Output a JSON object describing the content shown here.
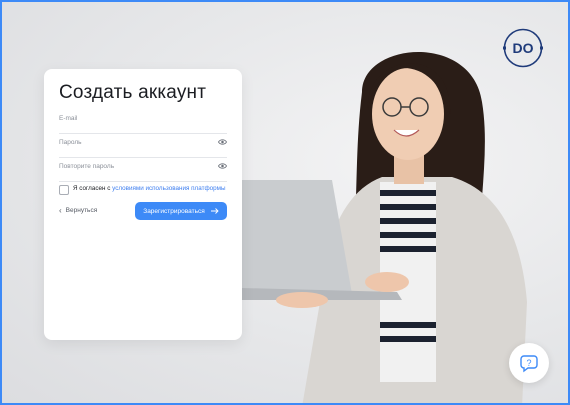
{
  "form": {
    "title": "Создать аккаунт",
    "fields": [
      {
        "label": "E-mail"
      },
      {
        "label": "Пароль"
      },
      {
        "label": "Повторите пароль"
      }
    ],
    "agree_prefix": "Я согласен с ",
    "agree_link": "условиями использования платформы",
    "back_label": "Вернуться",
    "submit_label": "Зарегистрироваться"
  },
  "brand": {
    "logo_text": "DO",
    "accent_color": "#3d8af7",
    "logo_color": "#1f3b7a"
  },
  "icons": [
    "eye-icon",
    "chevron-left-icon",
    "arrow-right-icon",
    "help-chat-icon"
  ]
}
